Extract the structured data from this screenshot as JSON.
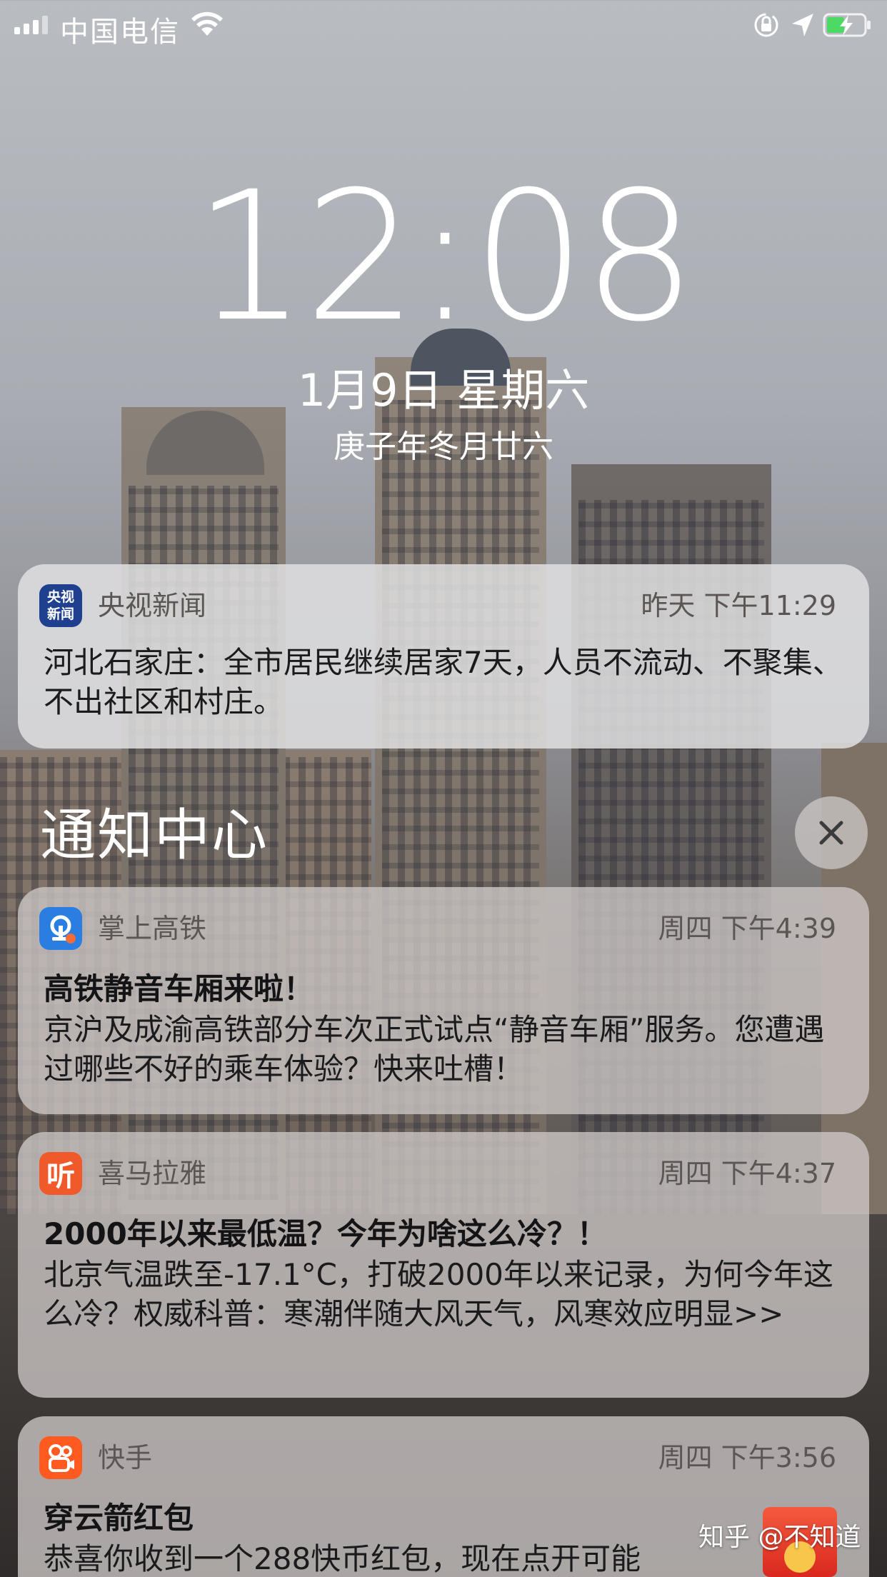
{
  "status_bar": {
    "carrier": "中国电信",
    "icons": [
      "signal-icon",
      "wifi-icon",
      "rotation-lock-icon",
      "location-arrow-icon",
      "battery-charging-icon"
    ],
    "battery_color": "#4cd964"
  },
  "lock_screen": {
    "time": "12:08",
    "date": "1月9日 星期六",
    "lunar_date": "庚子年冬月廿六"
  },
  "notification_center": {
    "title": "通知中心",
    "close_icon": "close-icon"
  },
  "notifications": [
    {
      "app": "央视新闻",
      "icon_text_1": "央视",
      "icon_text_2": "新闻",
      "time": "昨天 下午11:29",
      "title": "",
      "body": "河北石家庄：全市居民继续居家7天，人员不流动、不聚集、不出社区和村庄。",
      "icon_color": "#1f3f8f"
    },
    {
      "app": "掌上高铁",
      "time": "周四 下午4:39",
      "title": "高铁静音车厢来啦！",
      "body": "京沪及成渝高铁部分车次正式试点“静音车厢”服务。您遭遇过哪些不好的乘车体验？快来吐槽！",
      "icon_color": "#2a7de1"
    },
    {
      "app": "喜马拉雅",
      "icon_glyph": "听",
      "time": "周四 下午4:37",
      "title": "2000年以来最低温？今年为啥这么冷？！",
      "body": "北京气温跌至-17.1°C，打破2000年以来记录，为何今年这么冷？权威科普：寒潮伴随大风天气，风寒效应明显>>",
      "icon_color": "#f05a2a"
    },
    {
      "app": "快手",
      "time": "周四 下午3:56",
      "title": "穿云箭红包",
      "body": "恭喜你收到一个288快币红包，现在点开可能",
      "icon_color": "#ff5a1f"
    }
  ],
  "watermark": "知乎 @不知道"
}
